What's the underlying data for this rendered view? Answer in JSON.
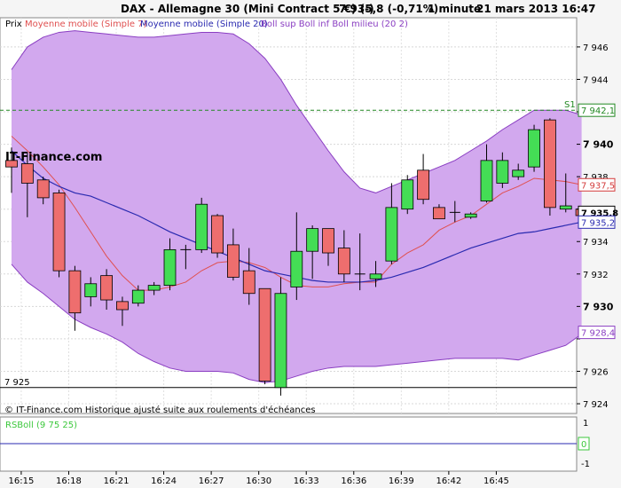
{
  "header": {
    "instrument": "DAX - Allemagne 30 (Mini Contract 5 €) (-)",
    "quote": "7 935,8 (-0,71%)",
    "interval": "1 minute",
    "datetime": "21 mars 2013 16:47"
  },
  "legend": {
    "prix": "Prix",
    "mm7": "Moyenne mobile (Simple 7)",
    "mm20": "Moyenne mobile (Simple 20)",
    "boll": "Boll sup Boll inf Boll milieu (20 2)"
  },
  "watermark": "IT-Finance.com",
  "footer_note": "© IT-Finance.com  Historique ajusté suite aux roulements d'échéances",
  "sub_panel": {
    "label": "RSBoll (9 75 25)",
    "value_tag": "0",
    "ticks": [
      "1",
      "0",
      "-1"
    ]
  },
  "colors": {
    "band_fill": "#d2a8ee",
    "band_edge": "#8a3ec2",
    "ma7": "#e05050",
    "ma20": "#2a2ab0",
    "up": "#44dd55",
    "down": "#ee6e6e",
    "resistance": "#228822",
    "tag_red": "#d43c3c",
    "tag_blue": "#2a2ab0",
    "tag_purple": "#8a3ec2",
    "rsboll": "#3cc83c"
  },
  "chart_data": {
    "type": "candlestick",
    "title": "DAX - Allemagne 30 (Mini Contract 5 €) (-)",
    "ylim": [
      7923.4,
      7947.8
    ],
    "y_ticks": [
      7924,
      7926,
      7928,
      7930,
      7932,
      7934,
      7936,
      7938,
      7940,
      7942,
      7944,
      7946
    ],
    "y_tick_labels": [
      "7 924",
      "7 926",
      "",
      "7 930",
      "7 932",
      "7 934",
      "",
      "7 938",
      "7 940",
      "",
      "7 944",
      "7 946"
    ],
    "bold_ticks": [
      7930,
      7940
    ],
    "x_labels": [
      "16:15",
      "16:18",
      "16:21",
      "16:24",
      "16:27",
      "16:30",
      "16:33",
      "16:36",
      "16:39",
      "16:42",
      "16:45"
    ],
    "x_label_positions": [
      0.5,
      3.5,
      6.5,
      9.5,
      12.5,
      15.5,
      18.5,
      21.5,
      24.5,
      27.5,
      30.5
    ],
    "candles": [
      {
        "o": 7939.0,
        "h": 7939.8,
        "l": 7937.0,
        "c": 7938.6
      },
      {
        "o": 7938.8,
        "h": 7939.5,
        "l": 7935.5,
        "c": 7937.6
      },
      {
        "o": 7937.8,
        "h": 7938.0,
        "l": 7936.3,
        "c": 7936.7
      },
      {
        "o": 7937.0,
        "h": 7937.2,
        "l": 7931.8,
        "c": 7932.2
      },
      {
        "o": 7932.2,
        "h": 7932.5,
        "l": 7928.5,
        "c": 7929.6
      },
      {
        "o": 7930.6,
        "h": 7931.8,
        "l": 7930.0,
        "c": 7931.4
      },
      {
        "o": 7931.9,
        "h": 7932.3,
        "l": 7929.8,
        "c": 7930.4
      },
      {
        "o": 7930.3,
        "h": 7930.6,
        "l": 7928.8,
        "c": 7929.8
      },
      {
        "o": 7930.2,
        "h": 7931.3,
        "l": 7930.0,
        "c": 7931.0
      },
      {
        "o": 7931.0,
        "h": 7931.5,
        "l": 7930.7,
        "c": 7931.3
      },
      {
        "o": 7931.3,
        "h": 7934.2,
        "l": 7931.0,
        "c": 7933.5
      },
      {
        "o": 7933.5,
        "h": 7933.8,
        "l": 7932.3,
        "c": 7933.5
      },
      {
        "o": 7933.5,
        "h": 7936.7,
        "l": 7933.3,
        "c": 7936.3
      },
      {
        "o": 7935.6,
        "h": 7935.7,
        "l": 7933.0,
        "c": 7933.3
      },
      {
        "o": 7933.8,
        "h": 7934.8,
        "l": 7931.6,
        "c": 7931.8
      },
      {
        "o": 7932.2,
        "h": 7933.6,
        "l": 7930.1,
        "c": 7930.8
      },
      {
        "o": 7931.1,
        "h": 7931.1,
        "l": 7925.2,
        "c": 7925.4
      },
      {
        "o": 7925.0,
        "h": 7931.8,
        "l": 7924.5,
        "c": 7930.8
      },
      {
        "o": 7931.2,
        "h": 7935.8,
        "l": 7930.4,
        "c": 7933.4
      },
      {
        "o": 7933.4,
        "h": 7935.0,
        "l": 7931.7,
        "c": 7934.8
      },
      {
        "o": 7934.8,
        "h": 7934.8,
        "l": 7932.5,
        "c": 7933.3
      },
      {
        "o": 7933.6,
        "h": 7934.7,
        "l": 7931.5,
        "c": 7932.0
      },
      {
        "o": 7932.0,
        "h": 7934.5,
        "l": 7931.0,
        "c": 7931.9
      },
      {
        "o": 7931.7,
        "h": 7932.8,
        "l": 7931.2,
        "c": 7932.0
      },
      {
        "o": 7932.8,
        "h": 7937.6,
        "l": 7932.6,
        "c": 7936.1
      },
      {
        "o": 7936.0,
        "h": 7938.1,
        "l": 7935.7,
        "c": 7937.8
      },
      {
        "o": 7938.4,
        "h": 7939.4,
        "l": 7936.3,
        "c": 7936.6
      },
      {
        "o": 7936.1,
        "h": 7936.3,
        "l": 7935.7,
        "c": 7935.4
      },
      {
        "o": 7935.7,
        "h": 7936.5,
        "l": 7935.2,
        "c": 7935.8
      },
      {
        "o": 7935.5,
        "h": 7935.8,
        "l": 7935.4,
        "c": 7935.7
      },
      {
        "o": 7936.5,
        "h": 7940.0,
        "l": 7936.4,
        "c": 7939.0
      },
      {
        "o": 7937.6,
        "h": 7939.5,
        "l": 7937.3,
        "c": 7939.0
      },
      {
        "o": 7938.0,
        "h": 7938.8,
        "l": 7937.8,
        "c": 7938.4
      },
      {
        "o": 7938.6,
        "h": 7941.2,
        "l": 7938.3,
        "c": 7940.9
      },
      {
        "o": 7941.5,
        "h": 7941.6,
        "l": 7935.6,
        "c": 7936.1
      },
      {
        "o": 7936.0,
        "h": 7938.2,
        "l": 7935.8,
        "c": 7936.2
      },
      {
        "o": 7936.0,
        "h": 7936.1,
        "l": 7935.3,
        "c": 7935.6
      }
    ],
    "bollinger_upper": [
      7944.6,
      7946.0,
      7946.6,
      7946.9,
      7947.0,
      7946.9,
      7946.8,
      7946.7,
      7946.6,
      7946.6,
      7946.7,
      7946.8,
      7946.9,
      7946.9,
      7946.8,
      7946.2,
      7945.3,
      7944.0,
      7942.4,
      7941.0,
      7939.6,
      7938.3,
      7937.3,
      7937.0,
      7937.4,
      7937.8,
      7938.2,
      7938.6,
      7939.0,
      7939.6,
      7940.2,
      7940.9,
      7941.5,
      7942.1,
      7942.1,
      7942.1,
      7941.8
    ],
    "bollinger_lower": [
      7932.6,
      7931.5,
      7930.8,
      7930.0,
      7929.2,
      7928.7,
      7928.3,
      7927.8,
      7927.1,
      7926.6,
      7926.2,
      7926.0,
      7926.0,
      7926.0,
      7925.9,
      7925.5,
      7925.3,
      7925.4,
      7925.7,
      7926.0,
      7926.2,
      7926.3,
      7926.3,
      7926.3,
      7926.4,
      7926.5,
      7926.6,
      7926.7,
      7926.8,
      7926.8,
      7926.8,
      7926.8,
      7926.7,
      7927.0,
      7927.3,
      7927.6,
      7928.3
    ],
    "bollinger_mid": [
      7939.6,
      7938.7,
      7937.9,
      7937.4,
      7937.0,
      7936.8,
      7936.4,
      7936.0,
      7935.6,
      7935.1,
      7934.6,
      7934.2,
      7933.8,
      7933.4,
      7933.0,
      7932.6,
      7932.2,
      7932.0,
      7931.8,
      7931.6,
      7931.5,
      7931.5,
      7931.5,
      7931.6,
      7931.8,
      7932.1,
      7932.4,
      7932.8,
      7933.2,
      7933.6,
      7933.9,
      7934.2,
      7934.5,
      7934.6,
      7934.8,
      7935.0,
      7935.2
    ],
    "ma7": [
      7940.5,
      7939.6,
      7938.6,
      7937.5,
      7936.1,
      7934.6,
      7933.1,
      7931.9,
      7931.0,
      7931.0,
      7931.2,
      7931.5,
      7932.2,
      7932.7,
      7932.8,
      7932.7,
      7932.4,
      7931.8,
      7931.3,
      7931.2,
      7931.2,
      7931.4,
      7931.5,
      7931.5,
      7932.6,
      7933.3,
      7933.8,
      7934.7,
      7935.2,
      7935.6,
      7936.3,
      7937.0,
      7937.4,
      7937.9,
      7937.8,
      7937.7,
      7937.5
    ],
    "levels": {
      "s1": 7942.1,
      "low_line": 7925.0
    },
    "level_labels": {
      "s1": "S1",
      "low_line": "7 925"
    },
    "price_tags": [
      {
        "value": 7942.1,
        "label": "7 942,1",
        "style": "box-green"
      },
      {
        "value": 7937.5,
        "label": "7 937,5",
        "style": "red"
      },
      {
        "value": 7935.8,
        "label": "7 935,8",
        "style": "last"
      },
      {
        "value": 7935.2,
        "label": "7 935,2",
        "style": "blue"
      },
      {
        "value": 7928.4,
        "label": "7 928,4",
        "style": "purple"
      }
    ]
  }
}
